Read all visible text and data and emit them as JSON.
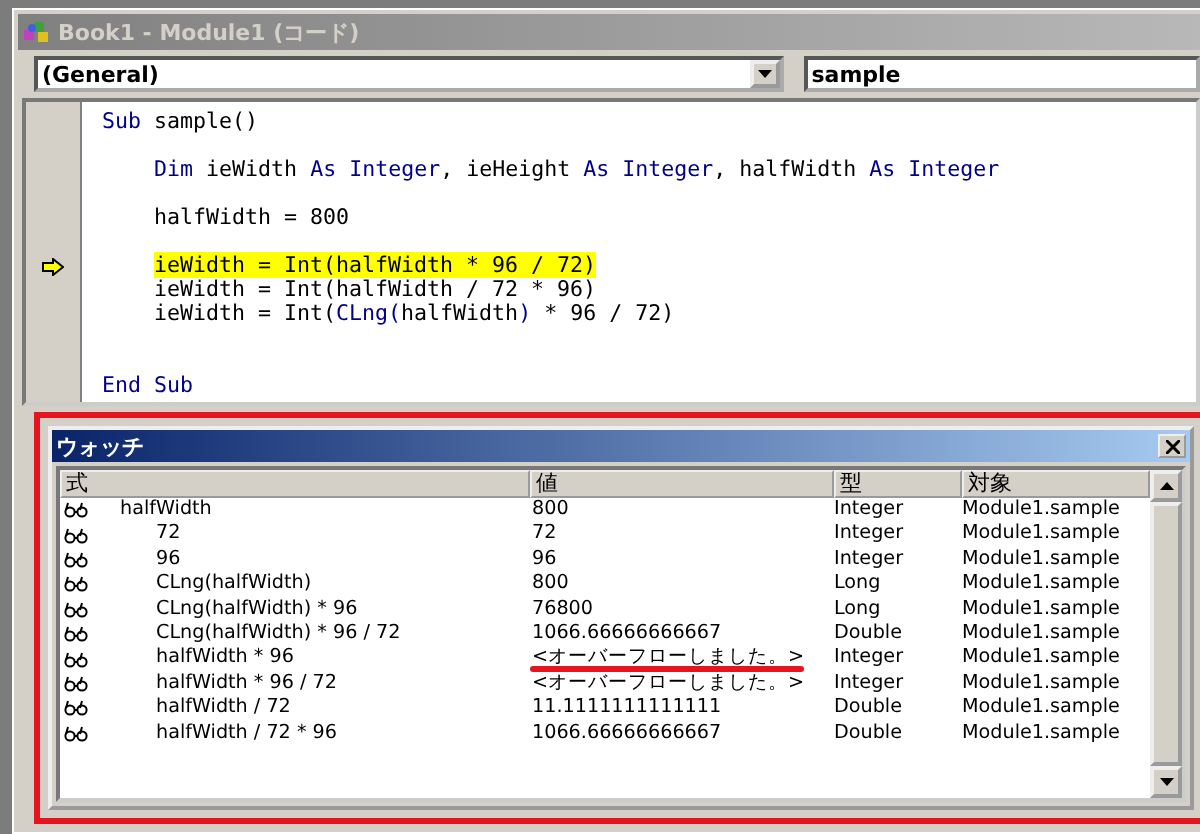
{
  "window": {
    "title": "Book1 - Module1 (コード)"
  },
  "object_box": {
    "value": "(General)"
  },
  "procedure_box": {
    "value": "sample"
  },
  "code": [
    {
      "kind": "code",
      "current": false,
      "segments": [
        {
          "text": "Sub",
          "kind": "keyword"
        },
        {
          "text": " sample()",
          "kind": "plain"
        }
      ]
    },
    {
      "kind": "blank"
    },
    {
      "kind": "code",
      "current": false,
      "segments": [
        {
          "text": "    Dim",
          "kind": "keyword"
        },
        {
          "text": " ieWidth ",
          "kind": "plain"
        },
        {
          "text": "As Integer",
          "kind": "keyword"
        },
        {
          "text": ", ieHeight ",
          "kind": "plain"
        },
        {
          "text": "As Integer",
          "kind": "keyword"
        },
        {
          "text": ", halfWidth ",
          "kind": "plain"
        },
        {
          "text": "As Integer",
          "kind": "keyword"
        }
      ]
    },
    {
      "kind": "blank"
    },
    {
      "kind": "code",
      "current": false,
      "segments": [
        {
          "text": "    halfWidth = 800",
          "kind": "plain"
        }
      ]
    },
    {
      "kind": "blank"
    },
    {
      "kind": "code",
      "current": true,
      "segments": [
        {
          "text": "    ieWidth = Int(halfWidth * 96 / 72)",
          "kind": "plain"
        }
      ]
    },
    {
      "kind": "code",
      "current": false,
      "segments": [
        {
          "text": "    ieWidth = Int(halfWidth / 72 * 96)",
          "kind": "plain"
        }
      ]
    },
    {
      "kind": "code",
      "current": false,
      "segments": [
        {
          "text": "    ieWidth = Int(",
          "kind": "plain"
        },
        {
          "text": "CLng(",
          "kind": "keyword"
        },
        {
          "text": "halfWidth",
          "kind": "plain"
        },
        {
          "text": ")",
          "kind": "keyword"
        },
        {
          "text": " * 96 / 72)",
          "kind": "plain"
        }
      ]
    },
    {
      "kind": "blank"
    },
    {
      "kind": "blank"
    },
    {
      "kind": "code",
      "current": false,
      "segments": [
        {
          "text": "End Sub",
          "kind": "keyword"
        }
      ]
    }
  ],
  "watch": {
    "title": "ウォッチ",
    "highlighted": true,
    "columns": [
      "式",
      "値",
      "型",
      "対象"
    ],
    "rows": [
      {
        "expression": "halfWidth",
        "value": "800",
        "type": "Integer",
        "context": "Module1.sample",
        "underlined": false,
        "children": [
          {
            "expression": "72",
            "value": "72",
            "type": "Integer",
            "context": "Module1.sample",
            "underlined": false
          },
          {
            "expression": "96",
            "value": "96",
            "type": "Integer",
            "context": "Module1.sample",
            "underlined": false
          },
          {
            "expression": "CLng(halfWidth)",
            "value": "800",
            "type": "Long",
            "context": "Module1.sample",
            "underlined": false
          },
          {
            "expression": "CLng(halfWidth) * 96",
            "value": "76800",
            "type": "Long",
            "context": "Module1.sample",
            "underlined": false
          },
          {
            "expression": "CLng(halfWidth) * 96 / 72",
            "value": "1066.66666666667",
            "type": "Double",
            "context": "Module1.sample",
            "underlined": false
          },
          {
            "expression": "halfWidth * 96",
            "value": "<オーバーフローしました。>",
            "type": "Integer",
            "context": "Module1.sample",
            "underlined": true
          },
          {
            "expression": "halfWidth * 96 / 72",
            "value": "<オーバーフローしました。>",
            "type": "Integer",
            "context": "Module1.sample",
            "underlined": false
          },
          {
            "expression": "halfWidth / 72",
            "value": "11.1111111111111",
            "type": "Double",
            "context": "Module1.sample",
            "underlined": false
          },
          {
            "expression": "halfWidth / 72 * 96",
            "value": "1066.66666666667",
            "type": "Double",
            "context": "Module1.sample",
            "underlined": false
          }
        ]
      }
    ]
  }
}
